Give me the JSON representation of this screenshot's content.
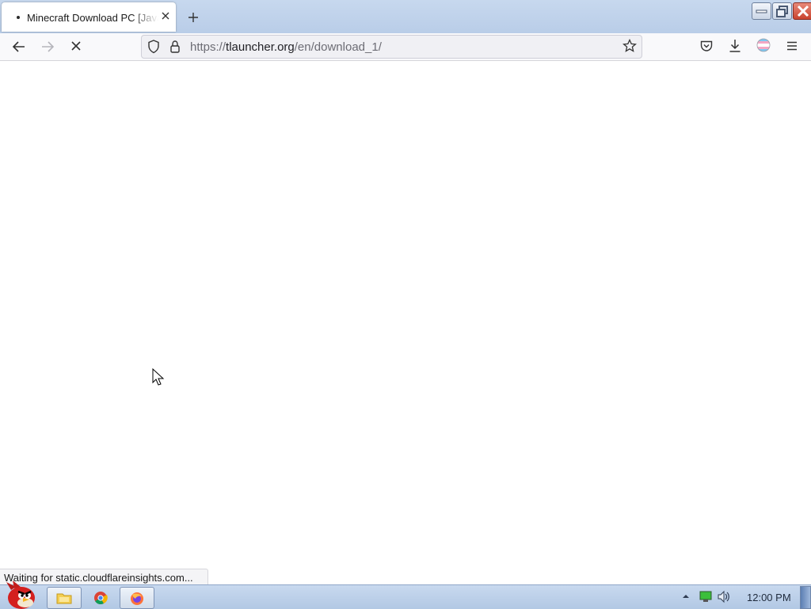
{
  "browser": {
    "tab": {
      "title": "Minecraft Download PC [Java Edition]",
      "loading_dot": "•"
    },
    "url": {
      "scheme": "https://",
      "host": "tlauncher.org",
      "path": "/en/download_1/"
    },
    "status_text": "Waiting for static.cloudflareinsights.com..."
  },
  "icons": {
    "tab_close": "close-icon",
    "new_tab": "plus-icon",
    "back": "arrow-left-icon",
    "forward": "arrow-right-icon",
    "stop": "stop-icon",
    "shield": "shield-icon",
    "lock": "lock-icon",
    "bookmark": "star-icon",
    "pocket": "pocket-icon",
    "downloads": "download-icon",
    "account": "account-avatar-icon",
    "menu": "hamburger-icon"
  },
  "taskbar": {
    "clock": "12:00 PM",
    "items": [
      "start-orb",
      "file-explorer",
      "chrome",
      "firefox"
    ]
  },
  "colors": {
    "titlebar": "#c7d8ee",
    "navbar": "#f9f9fb",
    "urlbar": "#f0f0f4",
    "taskbar": "#bdd0ea"
  }
}
